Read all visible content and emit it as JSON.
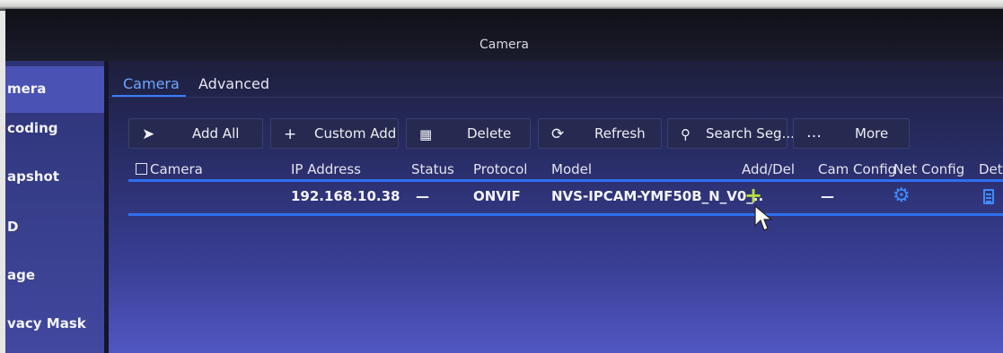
{
  "window": {
    "title": "Camera"
  },
  "sidebar": {
    "items": [
      {
        "label": "mera",
        "active": true
      },
      {
        "label": "coding"
      },
      {
        "label": "apshot"
      },
      {
        "label": "D"
      },
      {
        "label": "age"
      },
      {
        "label": "vacy Mask"
      }
    ]
  },
  "tabs": [
    {
      "label": "Camera",
      "active": true
    },
    {
      "label": "Advanced"
    }
  ],
  "toolbar": {
    "add_all": "Add All",
    "custom_add": "Custom Add",
    "delete": "Delete",
    "refresh": "Refresh",
    "search": "Search Seg...",
    "more": "More"
  },
  "table": {
    "columns": [
      "Camera",
      "IP Address",
      "Status",
      "Protocol",
      "Model",
      "Add/Del",
      "Cam Config",
      "Net Config",
      "Detai"
    ],
    "rows": [
      {
        "ip": "192.168.10.38",
        "status": "—",
        "protocol": "ONVIF",
        "model": "NVS-IPCAM-YMF50B_N_V0_..",
        "cam_config": "—"
      }
    ]
  },
  "icons": {
    "add_all": "add-all-icon",
    "custom_add": "plus-icon",
    "delete": "trash-icon",
    "refresh": "refresh-icon",
    "search": "search-icon",
    "more": "more-dots-icon",
    "add": "plus-icon",
    "net_config": "gear-icon",
    "detail": "document-icon"
  },
  "colors": {
    "accent": "#2f6ff0",
    "add_green": "#b8e03a",
    "icon_blue": "#3f8cff",
    "sidebar_bg": "#3a4090"
  }
}
